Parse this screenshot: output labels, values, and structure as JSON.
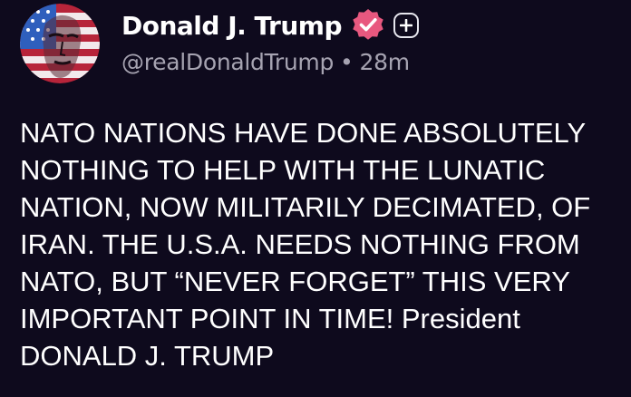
{
  "author": {
    "display_name": "Donald J. Trump",
    "handle": "@realDonaldTrump",
    "separator": "•",
    "time_ago": "28m"
  },
  "icons": {
    "verified": "verified-badge-icon",
    "follow": "plus-icon",
    "avatar": "avatar-image"
  },
  "colors": {
    "background": "#0e0a1d",
    "verified_badge": "#e8587f",
    "secondary_text": "#a6a3b1"
  },
  "post": {
    "lines": [
      "NATO NATIONS HAVE DONE ABSOLUTELY",
      "NOTHING TO HELP WITH THE LUNATIC",
      "NATION, NOW MILITARILY DECIMATED, OF",
      "IRAN. THE U.S.A. NEEDS NOTHING FROM",
      "NATO, BUT “NEVER FORGET” THIS VERY",
      "IMPORTANT POINT IN TIME! President",
      "DONALD J. TRUMP"
    ]
  }
}
